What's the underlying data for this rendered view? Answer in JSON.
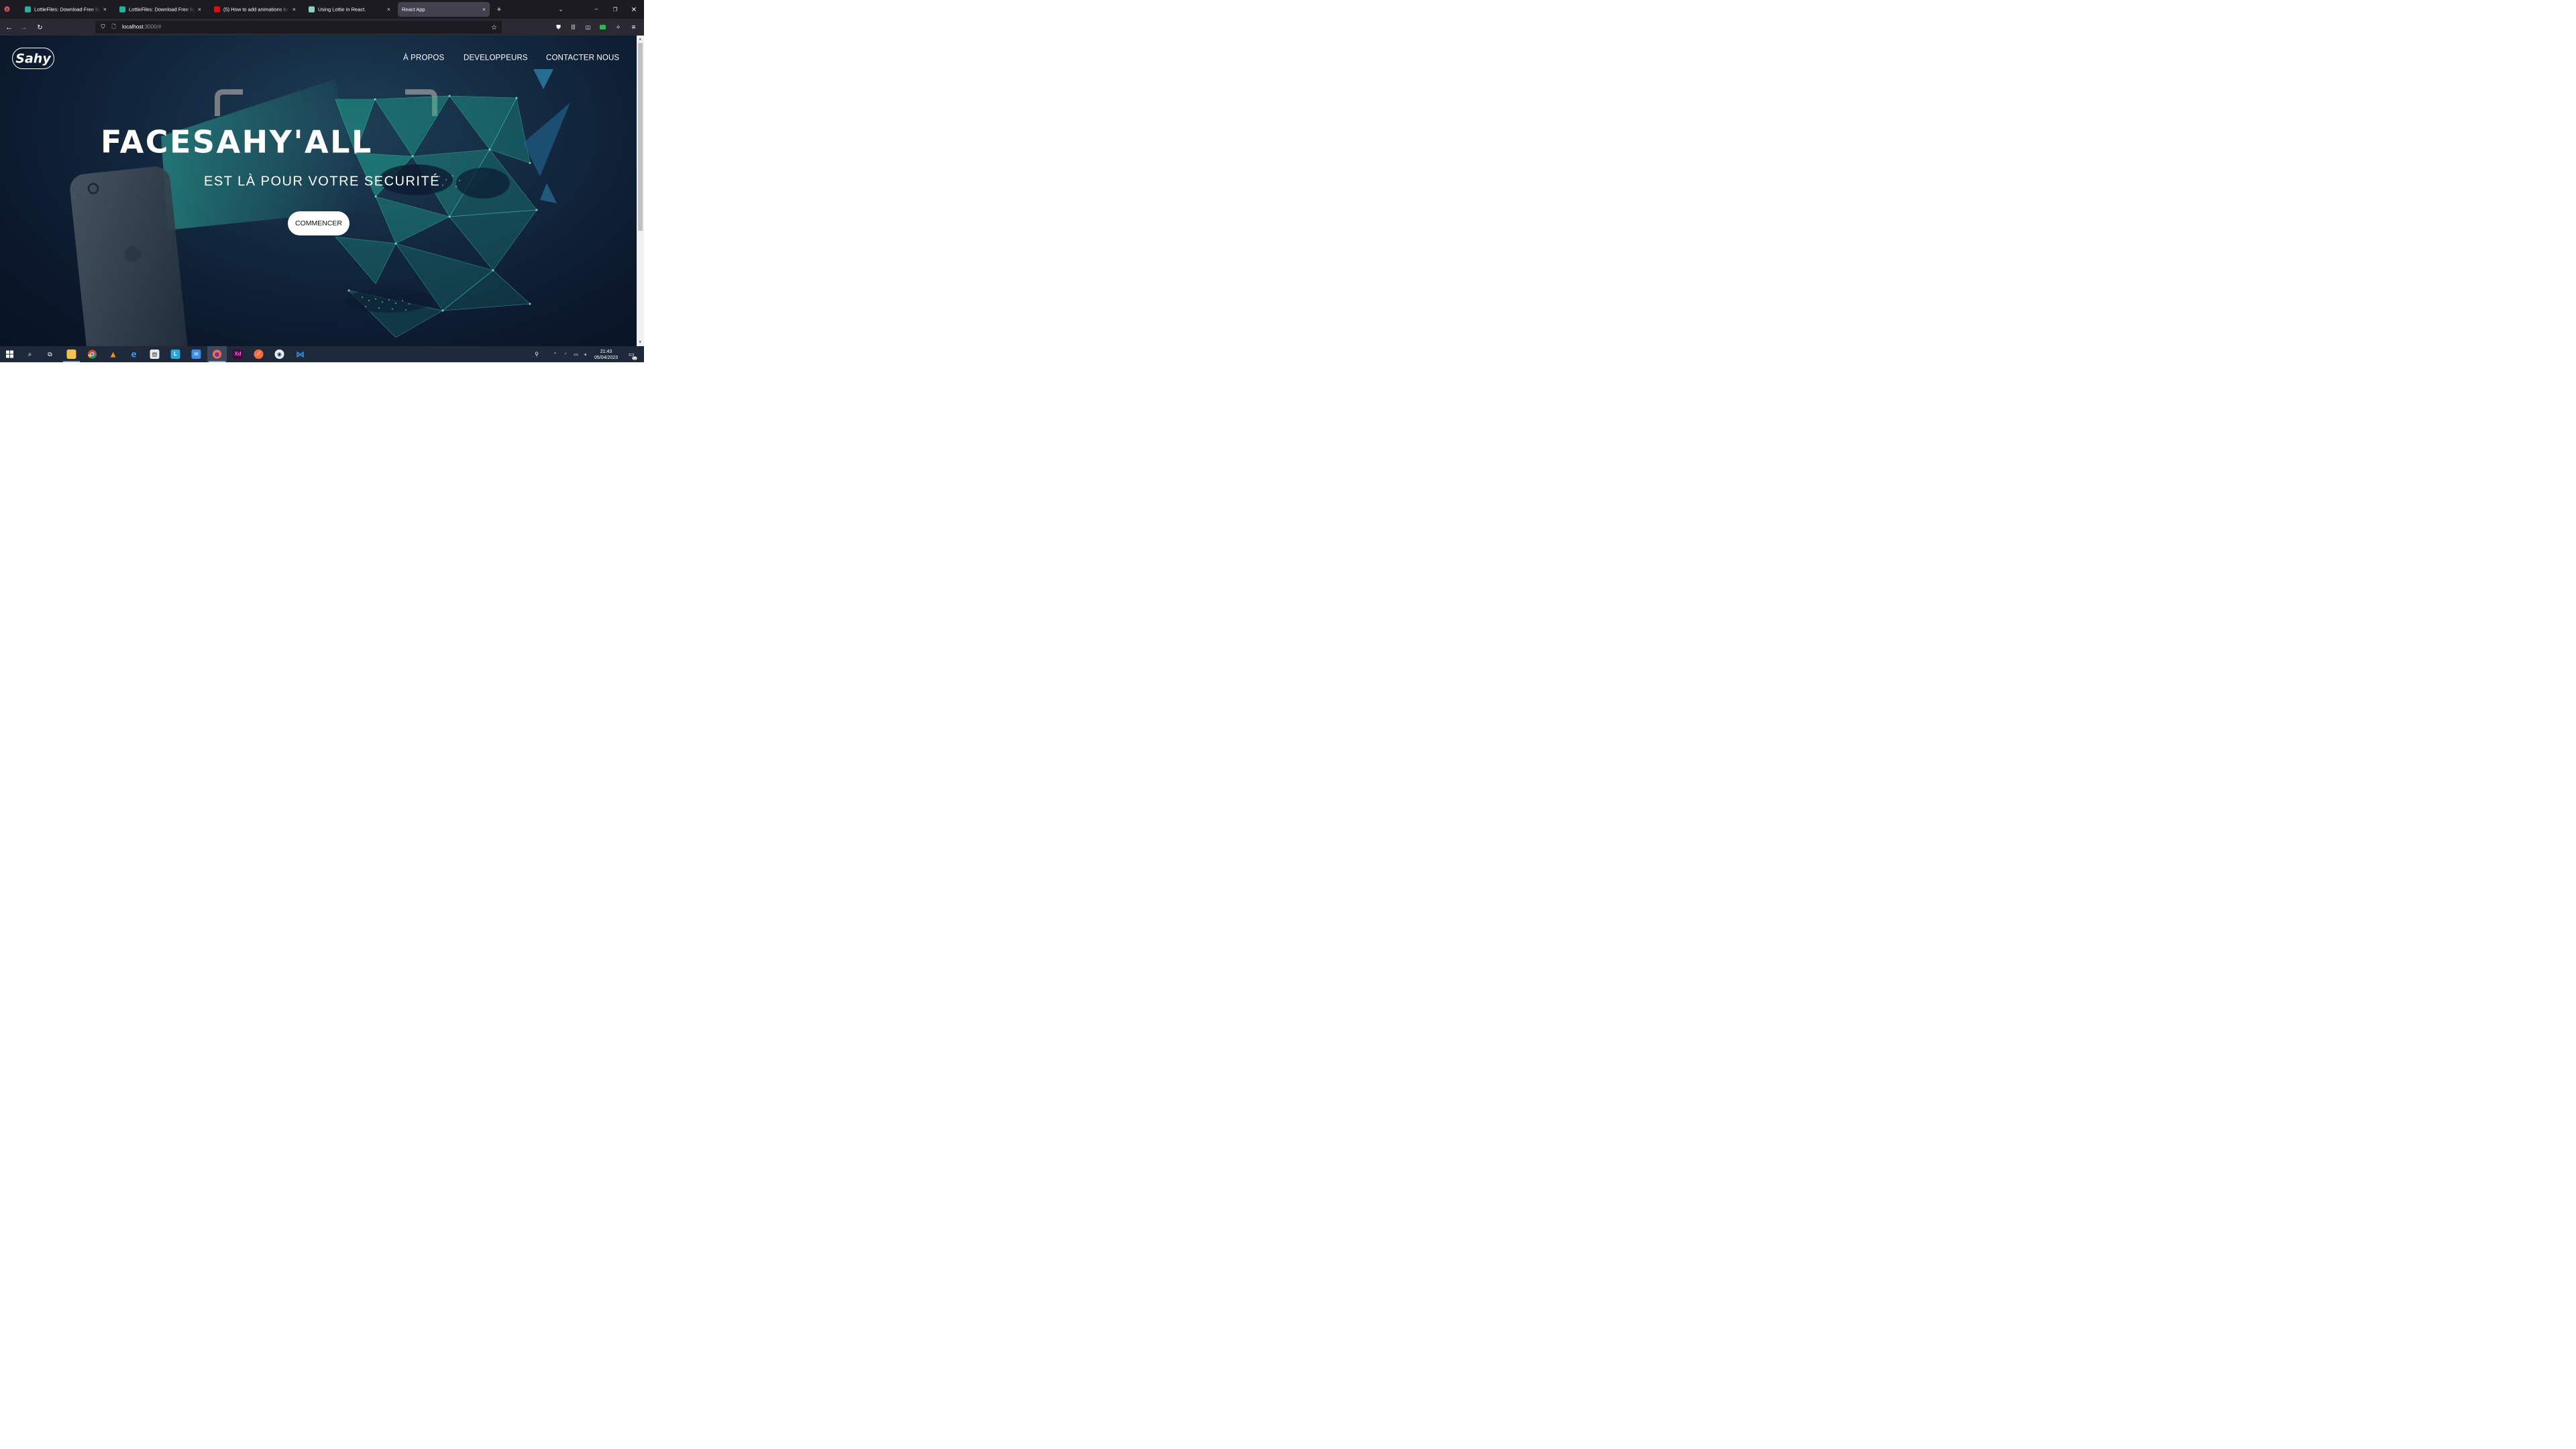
{
  "browser": {
    "tabs": [
      {
        "title": "LottieFiles: Download Free lightweight animations",
        "favicon": "lottiefiles-icon",
        "active": false
      },
      {
        "title": "LottieFiles: Download Free lightweight animations",
        "favicon": "lottiefiles-icon",
        "active": false
      },
      {
        "title": "(5) How to add animations to your React app",
        "favicon": "youtube-icon",
        "active": false
      },
      {
        "title": "Using Lottie in React.",
        "favicon": "generic-page-icon",
        "active": false
      },
      {
        "title": "React App",
        "favicon": "none",
        "active": true
      }
    ],
    "url": {
      "host": "localhost",
      "rest": ":3000/#"
    }
  },
  "page": {
    "logo": "Sahy",
    "nav": [
      "À PROPOS",
      "DEVELOPPEURS",
      "CONTACTER NOUS"
    ],
    "title": "FACESAHY'ALL",
    "subtitle": "EST LÀ POUR VOTRE SECURITÉ",
    "cta": "COMMENCER"
  },
  "taskbar": {
    "time": "21:43",
    "date": "05/04/2023",
    "notification_count": "11"
  },
  "colors": {
    "accent_teal": "#1fb59a",
    "content_bg": "#0c1a2e",
    "taskbar_bg": "#1e2a3a"
  }
}
